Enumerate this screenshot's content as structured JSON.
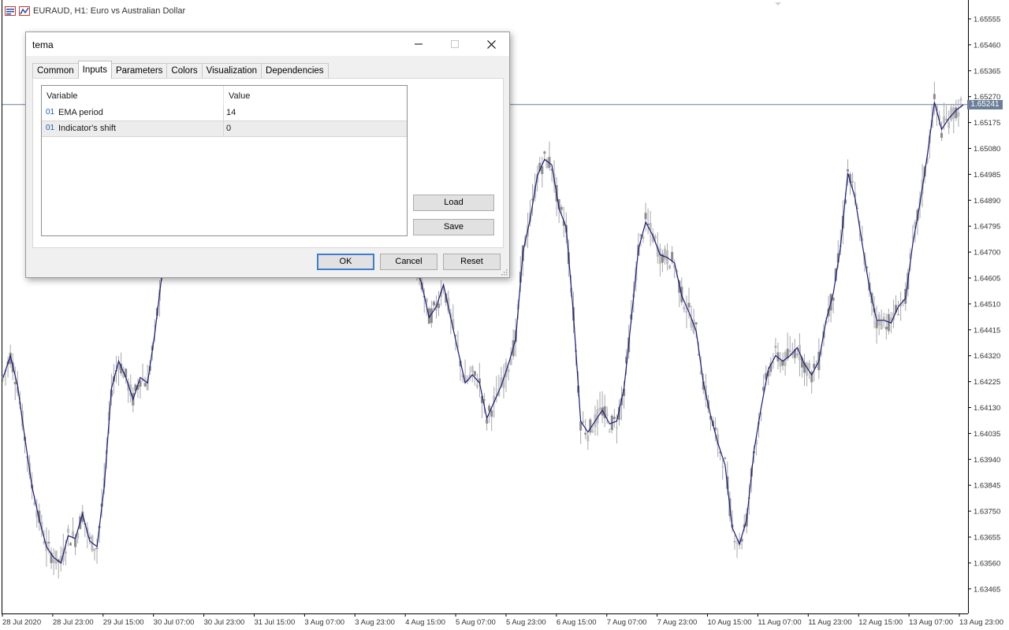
{
  "chart": {
    "symbol_title": "EURAUD, H1:  Euro vs Australian Dollar",
    "current_price_label": "1.65241",
    "price_axis_labels": [
      "1.65555",
      "1.65460",
      "1.65365",
      "1.65270",
      "1.65175",
      "1.65080",
      "1.64985",
      "1.64890",
      "1.64795",
      "1.64700",
      "1.64605",
      "1.64510",
      "1.64415",
      "1.64320",
      "1.64225",
      "1.64130",
      "1.64035",
      "1.63940",
      "1.63845",
      "1.63750",
      "1.63655",
      "1.63560",
      "1.63465"
    ],
    "time_axis_labels": [
      "28 Jul 2020",
      "28 Jul 23:00",
      "29 Jul 15:00",
      "30 Jul 07:00",
      "30 Jul 23:00",
      "31 Jul 15:00",
      "3 Aug 07:00",
      "3 Aug 23:00",
      "4 Aug 15:00",
      "5 Aug 07:00",
      "5 Aug 23:00",
      "6 Aug 15:00",
      "7 Aug 07:00",
      "7 Aug 23:00",
      "10 Aug 15:00",
      "11 Aug 07:00",
      "11 Aug 23:00",
      "12 Aug 15:00",
      "13 Aug 07:00",
      "13 Aug 23:00"
    ],
    "colors": {
      "candles": "#8c8c8c",
      "indicator_line": "#1a1a7a",
      "price_line": "#6b7f99",
      "price_tag": "#6b7f99",
      "axis": "#000000"
    },
    "indicator_series": [
      1.6424,
      1.6432,
      1.6421,
      1.6402,
      1.6384,
      1.6372,
      1.6362,
      1.6358,
      1.6356,
      1.6366,
      1.6365,
      1.6374,
      1.6364,
      1.6362,
      1.6384,
      1.642,
      1.643,
      1.6424,
      1.6416,
      1.6424,
      1.6422,
      1.644,
      1.6462,
      1.6484,
      1.6494,
      1.6493,
      1.6492,
      1.6484,
      1.6483,
      1.6486,
      1.6487,
      1.6486,
      1.6484,
      1.6484,
      1.6489,
      1.649,
      1.6487,
      1.649,
      1.6486,
      1.6493,
      1.6495,
      1.6492,
      1.6489,
      1.6486,
      1.649,
      1.6498,
      1.6506,
      1.65,
      1.6501,
      1.6484,
      1.6504,
      1.6492,
      1.6501,
      1.6505,
      1.6494,
      1.6505,
      1.65,
      1.6467,
      1.6458,
      1.6446,
      1.645,
      1.6458,
      1.6446,
      1.6434,
      1.6422,
      1.6425,
      1.6422,
      1.6409,
      1.6415,
      1.6421,
      1.6429,
      1.6438,
      1.647,
      1.6482,
      1.6498,
      1.6504,
      1.6502,
      1.6486,
      1.6479,
      1.6447,
      1.6408,
      1.6404,
      1.6408,
      1.6412,
      1.6407,
      1.6408,
      1.642,
      1.6445,
      1.6471,
      1.6481,
      1.6476,
      1.6469,
      1.6468,
      1.6466,
      1.6454,
      1.6448,
      1.6441,
      1.6422,
      1.641,
      1.64,
      1.6392,
      1.6369,
      1.6363,
      1.6372,
      1.6397,
      1.6413,
      1.6427,
      1.6432,
      1.643,
      1.6432,
      1.6435,
      1.6429,
      1.6425,
      1.643,
      1.6445,
      1.6455,
      1.6472,
      1.6499,
      1.649,
      1.6473,
      1.6457,
      1.6445,
      1.6445,
      1.6444,
      1.645,
      1.6453,
      1.6473,
      1.6488,
      1.6505,
      1.6525,
      1.6515,
      1.6519,
      1.6522,
      1.6524
    ]
  },
  "dialog": {
    "title": "tema",
    "tabs": [
      "Common",
      "Inputs",
      "Parameters",
      "Colors",
      "Visualization",
      "Dependencies"
    ],
    "active_tab": "Inputs",
    "grid": {
      "headers": [
        "Variable",
        "Value"
      ],
      "rows": [
        {
          "type": "01",
          "variable": "EMA period",
          "value": "14"
        },
        {
          "type": "01",
          "variable": "Indicator's shift",
          "value": "0"
        }
      ]
    },
    "buttons": {
      "load": "Load",
      "save": "Save",
      "ok": "OK",
      "cancel": "Cancel",
      "reset": "Reset"
    }
  }
}
